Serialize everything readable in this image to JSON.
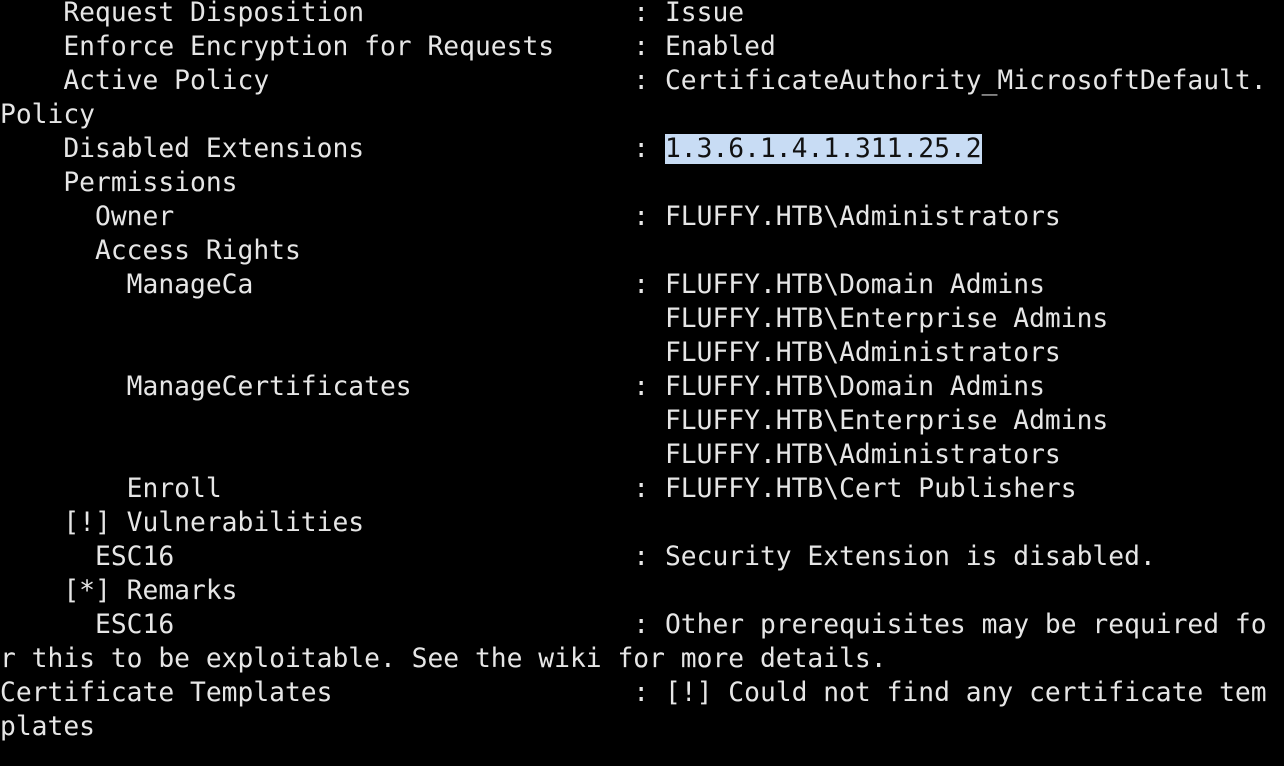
{
  "colors": {
    "background": "#000000",
    "text": "#e6e6e6",
    "selection_background": "#c8dcf4",
    "selection_text": "#111111"
  },
  "terminal": {
    "lines": [
      "    Request Disposition                 : Issue",
      "    Enforce Encryption for Requests     : Enabled",
      "    Active Policy                       : CertificateAuthority_MicrosoftDefault.",
      "Policy",
      "    Disabled Extensions                 : ",
      "    Permissions",
      "      Owner                             : FLUFFY.HTB\\Administrators",
      "      Access Rights",
      "        ManageCa                        : FLUFFY.HTB\\Domain Admins",
      "                                          FLUFFY.HTB\\Enterprise Admins",
      "                                          FLUFFY.HTB\\Administrators",
      "        ManageCertificates              : FLUFFY.HTB\\Domain Admins",
      "                                          FLUFFY.HTB\\Enterprise Admins",
      "                                          FLUFFY.HTB\\Administrators",
      "        Enroll                          : FLUFFY.HTB\\Cert Publishers",
      "    [!] Vulnerabilities",
      "      ESC16                             : Security Extension is disabled.",
      "    [*] Remarks",
      "      ESC16                             : Other prerequisites may be required fo",
      "r this to be exploitable. See the wiki for more details.",
      "Certificate Templates                   : [!] Could not find any certificate tem",
      "plates"
    ],
    "selected_text": "1.3.6.1.4.1.311.25.2"
  }
}
